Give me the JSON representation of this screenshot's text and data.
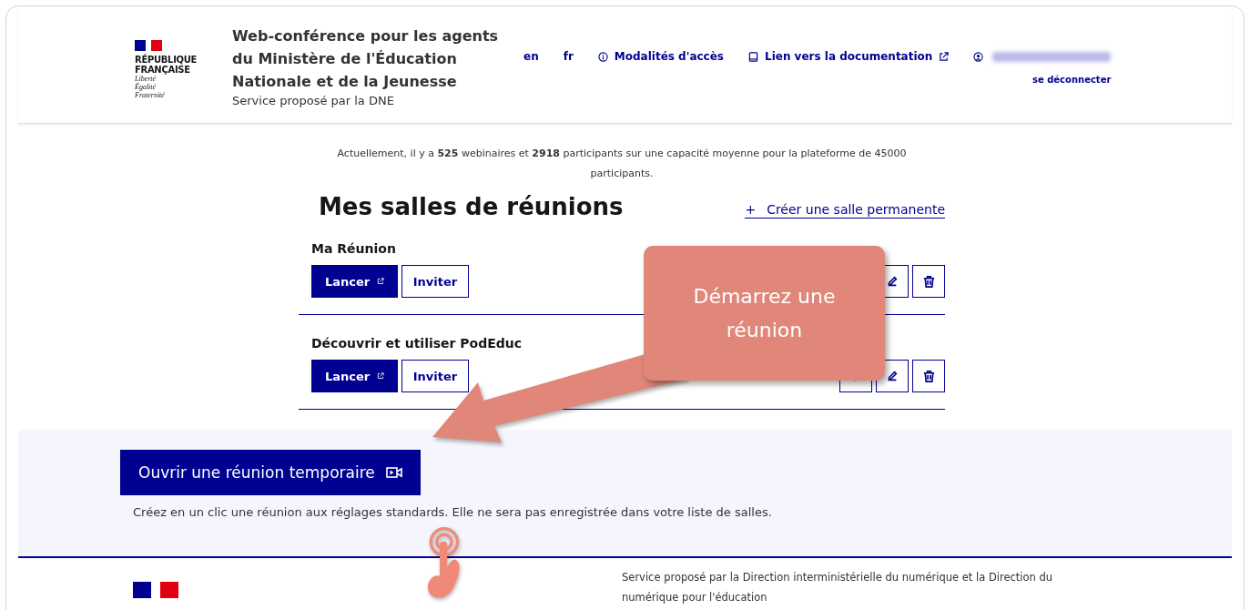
{
  "header": {
    "logo_title": [
      "RÉPUBLIQUE",
      "FRANÇAISE"
    ],
    "motto": [
      "Liberté",
      "Égalité",
      "Fraternité"
    ],
    "title": "Web-conférence pour les agents du Ministère de l'Éducation Nationale et de la Jeunesse",
    "subtitle": "Service proposé par la DNE",
    "nav": [
      {
        "label": "en",
        "kind": "plain",
        "external": false
      },
      {
        "label": "fr",
        "kind": "plain",
        "external": false
      },
      {
        "label": "Modalités d'accès",
        "kind": "info",
        "external": false
      },
      {
        "label": "Lien vers la documentation",
        "kind": "book",
        "external": true
      }
    ],
    "logout": "se déconnecter"
  },
  "stats": "Actuellement, il y a **525** webinaires et **2918** participants sur une capacité moyenne pour la plateforme de 45000 participants.",
  "rooms_title": "Mes salles de réunions",
  "create_link": {
    "icon": "+",
    "label": "Créer une salle permanente"
  },
  "rooms": [
    {
      "name": "Ma Réunion",
      "launch": "Lancer",
      "invite": "Inviter"
    },
    {
      "name": "Découvrir et utiliser PodEduc",
      "launch": "Lancer",
      "invite": "Inviter"
    }
  ],
  "temporary": {
    "button": "Ouvrir une réunion temporaire",
    "note": "Créez en un clic une réunion aux réglages standards. Elle ne sera pas enregistrée dans votre liste de salles."
  },
  "footer": {
    "text": "Service proposé par la Direction interministérielle du numérique et la Direction du numérique pour l'éducation"
  },
  "callout": {
    "text": "Démarrez une réunion"
  }
}
